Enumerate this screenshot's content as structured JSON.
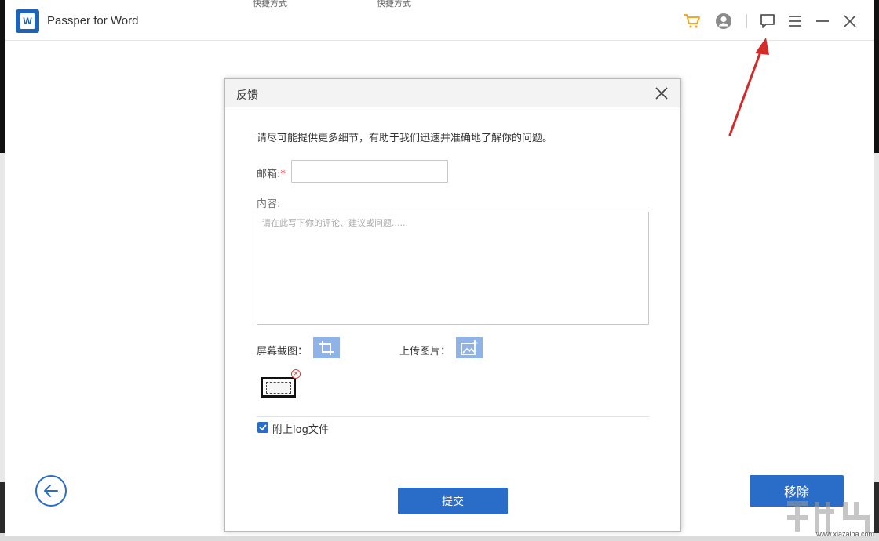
{
  "background": {
    "behind_titles": [
      "快捷方式",
      "快捷方式"
    ]
  },
  "app": {
    "title": "Passper for Word",
    "logo_letter": "W",
    "toolbar": {
      "cart_icon": "cart-icon",
      "account_icon": "account-icon",
      "feedback_icon": "feedback-icon",
      "menu_icon": "menu-icon",
      "minimize_icon": "minimize-icon",
      "close_icon": "close-icon"
    },
    "remove_button_label": "移除",
    "colors": {
      "accent": "#2a6dc8",
      "cart": "#f5a623"
    }
  },
  "dialog": {
    "title": "反馈",
    "intro": "请尽可能提供更多细节，有助于我们迅速并准确地了解你的问题。",
    "email_label": "邮箱:",
    "email_required_mark": "*",
    "email_value": "",
    "content_label": "内容:",
    "content_placeholder": "请在此写下你的评论、建议或问题......",
    "content_value": "",
    "screenshot_label": "屏幕截图：",
    "upload_label": "上传图片：",
    "attach_log_label": "附上log文件",
    "attach_log_checked": true,
    "submit_label": "提交"
  },
  "watermark": {
    "url": "www.xiazaiba.com"
  }
}
